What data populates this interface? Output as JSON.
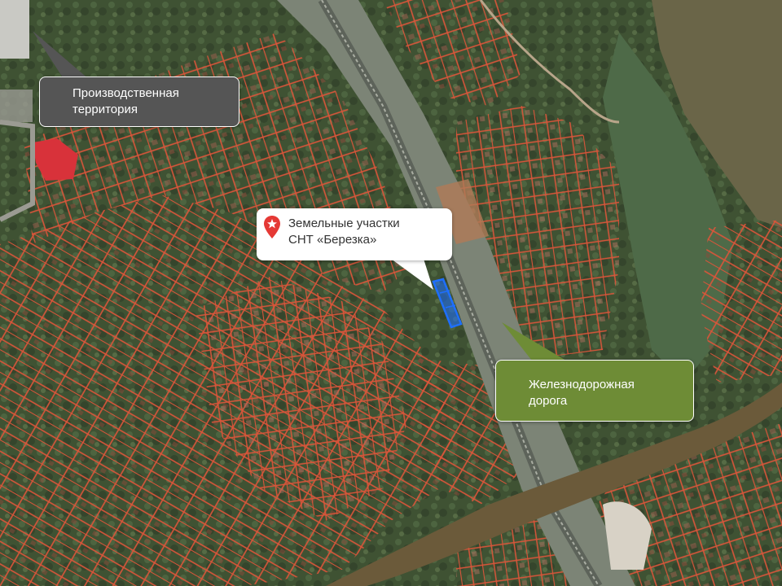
{
  "map": {
    "colors": {
      "parcel_outline": "#d9553a",
      "highlight_parcel": "#1e6fff",
      "river": "#6b5a3a",
      "railway_band": "#8c9088"
    }
  },
  "callouts": {
    "industrial": {
      "label_line1": "Производственная",
      "label_line2": "территория",
      "color": "#555555"
    },
    "plots": {
      "label_line1": "Земельные участки",
      "label_line2": "СНТ «Березка»",
      "icon": "star-pin-icon",
      "color": "#ffffff",
      "icon_color": "#e53935"
    },
    "railway": {
      "label_line1": "Железнодорожная",
      "label_line2": "дорога",
      "color": "#6e8c36"
    }
  }
}
